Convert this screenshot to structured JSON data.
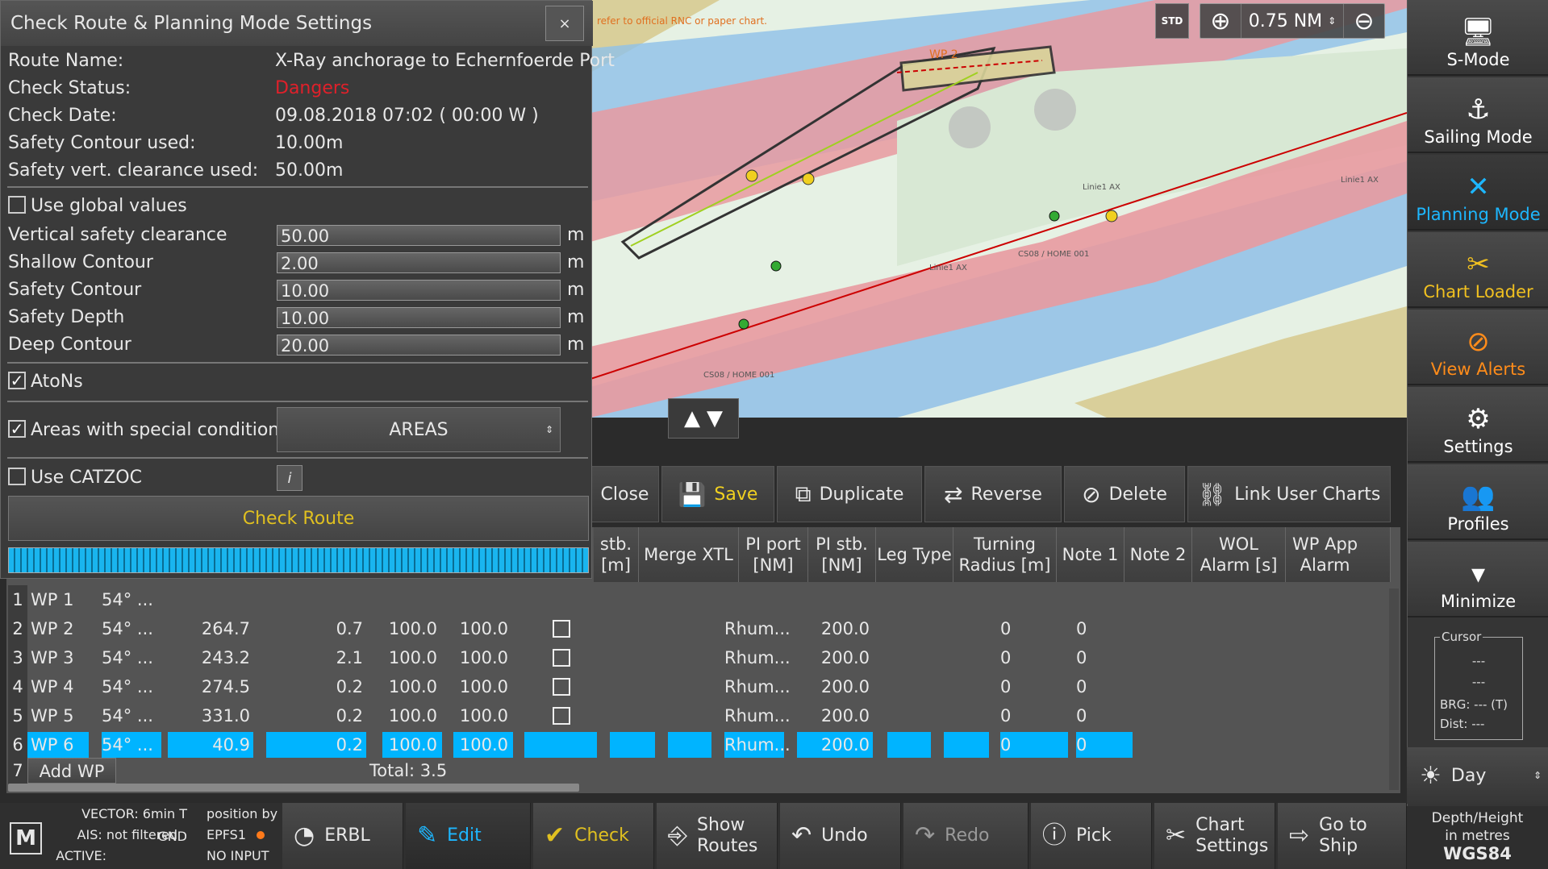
{
  "panel": {
    "title": "Check Route & Planning Mode Settings",
    "close_label": "×",
    "info": [
      {
        "label": "Route Name:",
        "value": "X-Ray anchorage to Echernfoerde Port"
      },
      {
        "label": "Check Status:",
        "value": "Dangers"
      },
      {
        "label": "Check Date:",
        "value": "09.08.2018 07:02 ( 00:00 W )"
      },
      {
        "label": "Safety Contour used:",
        "value": "10.00m"
      },
      {
        "label": "Safety vert. clearance used:",
        "value": "50.00m"
      }
    ],
    "use_global_label": "Use global values",
    "use_global_checked": false,
    "fields": [
      {
        "label": "Vertical safety clearance",
        "value": "50.00",
        "unit": "m"
      },
      {
        "label": "Shallow Contour",
        "value": "2.00",
        "unit": "m"
      },
      {
        "label": "Safety Contour",
        "value": "10.00",
        "unit": "m"
      },
      {
        "label": "Safety Depth",
        "value": "10.00",
        "unit": "m"
      },
      {
        "label": "Deep Contour",
        "value": "20.00",
        "unit": "m"
      }
    ],
    "atons_label": "AtoNs",
    "atons_checked": true,
    "areas_label": "Areas with special conditions",
    "areas_checked": true,
    "areas_button": "AREAS",
    "catzoc_label": "Use CATZOC",
    "catzoc_checked": false,
    "check_route_label": "Check Route",
    "status_color": "#e0202a"
  },
  "map": {
    "warning_text": "refer to official RNC or paper chart.",
    "std_label": "STD",
    "zoom_value": "0.75 NM",
    "labels": [
      "WP 2",
      "Linie1 AX",
      "CS08 / HOME 001",
      "CS08 / HOME 001",
      "Linie1 AX",
      "Linie1 AX"
    ]
  },
  "toolbar": {
    "close": "Close",
    "save": "Save",
    "duplicate": "Duplicate",
    "reverse": "Reverse",
    "delete": "Delete",
    "link_user_charts": "Link User Charts"
  },
  "table": {
    "headers": [
      "stb.\n[m]",
      "Merge XTL",
      "PI port\n[NM]",
      "PI stb.\n[NM]",
      "Leg Type",
      "Turning\nRadius [m]",
      "Note 1",
      "Note 2",
      "WOL\nAlarm [s]",
      "WP App\nAlarm"
    ],
    "rows": [
      {
        "idx": "1",
        "name": "WP 1",
        "pos": "54° ...",
        "a": "",
        "b": "",
        "c": "",
        "d": "",
        "merge": false,
        "leg": "",
        "radius": "",
        "wol": "",
        "app": ""
      },
      {
        "idx": "2",
        "name": "WP 2",
        "pos": "54° ...",
        "a": "264.7",
        "b": "0.7",
        "c": "100.0",
        "d": "100.0",
        "merge": true,
        "leg": "Rhum...",
        "radius": "200.0",
        "wol": "0",
        "app": "0"
      },
      {
        "idx": "3",
        "name": "WP 3",
        "pos": "54° ...",
        "a": "243.2",
        "b": "2.1",
        "c": "100.0",
        "d": "100.0",
        "merge": true,
        "leg": "Rhum...",
        "radius": "200.0",
        "wol": "0",
        "app": "0"
      },
      {
        "idx": "4",
        "name": "WP 4",
        "pos": "54° ...",
        "a": "274.5",
        "b": "0.2",
        "c": "100.0",
        "d": "100.0",
        "merge": true,
        "leg": "Rhum...",
        "radius": "200.0",
        "wol": "0",
        "app": "0"
      },
      {
        "idx": "5",
        "name": "WP 5",
        "pos": "54° ...",
        "a": "331.0",
        "b": "0.2",
        "c": "100.0",
        "d": "100.0",
        "merge": true,
        "leg": "Rhum...",
        "radius": "200.0",
        "wol": "0",
        "app": "0"
      },
      {
        "idx": "6",
        "name": "WP 6",
        "pos": "54° ...",
        "a": "40.9",
        "b": "0.2",
        "c": "100.0",
        "d": "100.0",
        "merge": false,
        "leg": "Rhum...",
        "radius": "200.0",
        "wol": "0",
        "app": "0"
      }
    ],
    "add_idx": "7",
    "add_wp": "Add WP",
    "total": "Total: 3.5",
    "selected_color": "#00b4ff"
  },
  "sidebar": {
    "items": [
      {
        "label": "S-Mode",
        "icon": "monitor-icon"
      },
      {
        "label": "Sailing Mode",
        "icon": "ship-icon"
      },
      {
        "label": "Planning Mode",
        "icon": "planning-icon"
      },
      {
        "label": "Chart Loader",
        "icon": "chart-loader-icon"
      },
      {
        "label": "View Alerts",
        "icon": "alert-icon"
      },
      {
        "label": "Settings",
        "icon": "gear-icon"
      },
      {
        "label": "Profiles",
        "icon": "profiles-icon"
      },
      {
        "label": "Minimize",
        "icon": "chevron-down-icon"
      }
    ],
    "cursor": {
      "legend": "Cursor",
      "l1": "---",
      "l2": "---",
      "brg": "BRG: --- (T)",
      "dist": "Dist: ---"
    },
    "day": "Day",
    "depth1": "Depth/Height",
    "depth2": "in metres",
    "datum": "WGS84"
  },
  "status": {
    "vector": "VECTOR: 6min T GND",
    "ais": "AIS: not filtered",
    "active": "ACTIVE:",
    "position_by": "position by",
    "epfs": "EPFS1",
    "no_input": "NO INPUT",
    "logo": "M"
  },
  "bottom": {
    "erbl": "ERBL",
    "edit": "Edit",
    "check": "Check",
    "show": "Show",
    "routes": "Routes",
    "undo": "Undo",
    "redo": "Redo",
    "pick": "Pick",
    "chart": "Chart",
    "settings": "Settings",
    "goto": "Go to",
    "ship": "Ship"
  }
}
